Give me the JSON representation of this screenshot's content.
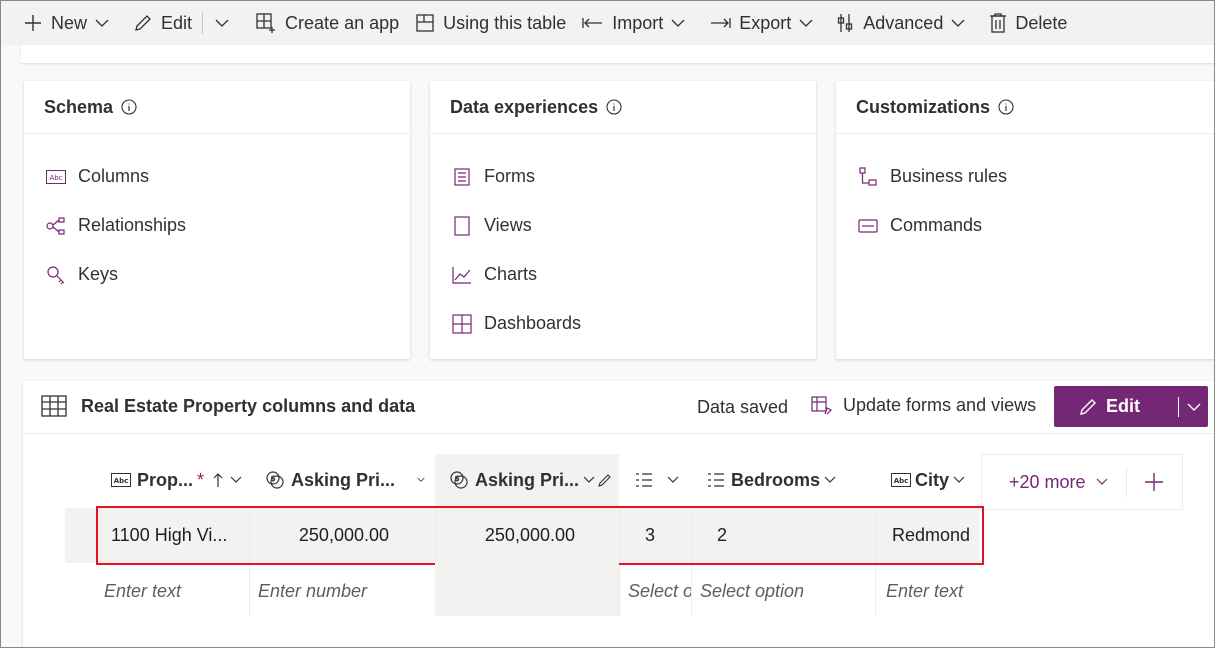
{
  "toolbar": {
    "new": "New",
    "edit": "Edit",
    "create_app": "Create an app",
    "using_table": "Using this table",
    "import": "Import",
    "export": "Export",
    "advanced": "Advanced",
    "delete": "Delete"
  },
  "schema": {
    "title": "Schema",
    "items": [
      "Columns",
      "Relationships",
      "Keys"
    ]
  },
  "data_experiences": {
    "title": "Data experiences",
    "items": [
      "Forms",
      "Views",
      "Charts",
      "Dashboards"
    ]
  },
  "customizations": {
    "title": "Customizations",
    "items": [
      "Business rules",
      "Commands"
    ]
  },
  "data_section": {
    "title": "Real Estate Property columns and data",
    "status": "Data saved",
    "update_label": "Update forms and views",
    "edit_label": "Edit",
    "more_columns": "+20 more"
  },
  "columns": [
    {
      "label": "Prop...",
      "required_mark": "*",
      "type_icon": "text-icon"
    },
    {
      "label": "Asking Pri...",
      "type_icon": "currency-icon"
    },
    {
      "label": "Asking Pri...",
      "type_icon": "currency-icon"
    },
    {
      "label": "",
      "type_icon": "choice-icon"
    },
    {
      "label": "Bedrooms",
      "type_icon": "choice-icon"
    },
    {
      "label": "City",
      "type_icon": "text-icon"
    }
  ],
  "row": {
    "property": "1100 High Vi...",
    "asking_price": "250,000.00",
    "asking_price_2": "250,000.00",
    "col4": "3",
    "bedrooms": "2",
    "city": "Redmond"
  },
  "placeholders": {
    "text": "Enter text",
    "number": "Enter number",
    "select": "Select option",
    "text2": "Enter text"
  },
  "colors": {
    "accent": "#742774",
    "highlight": "#e81123"
  }
}
